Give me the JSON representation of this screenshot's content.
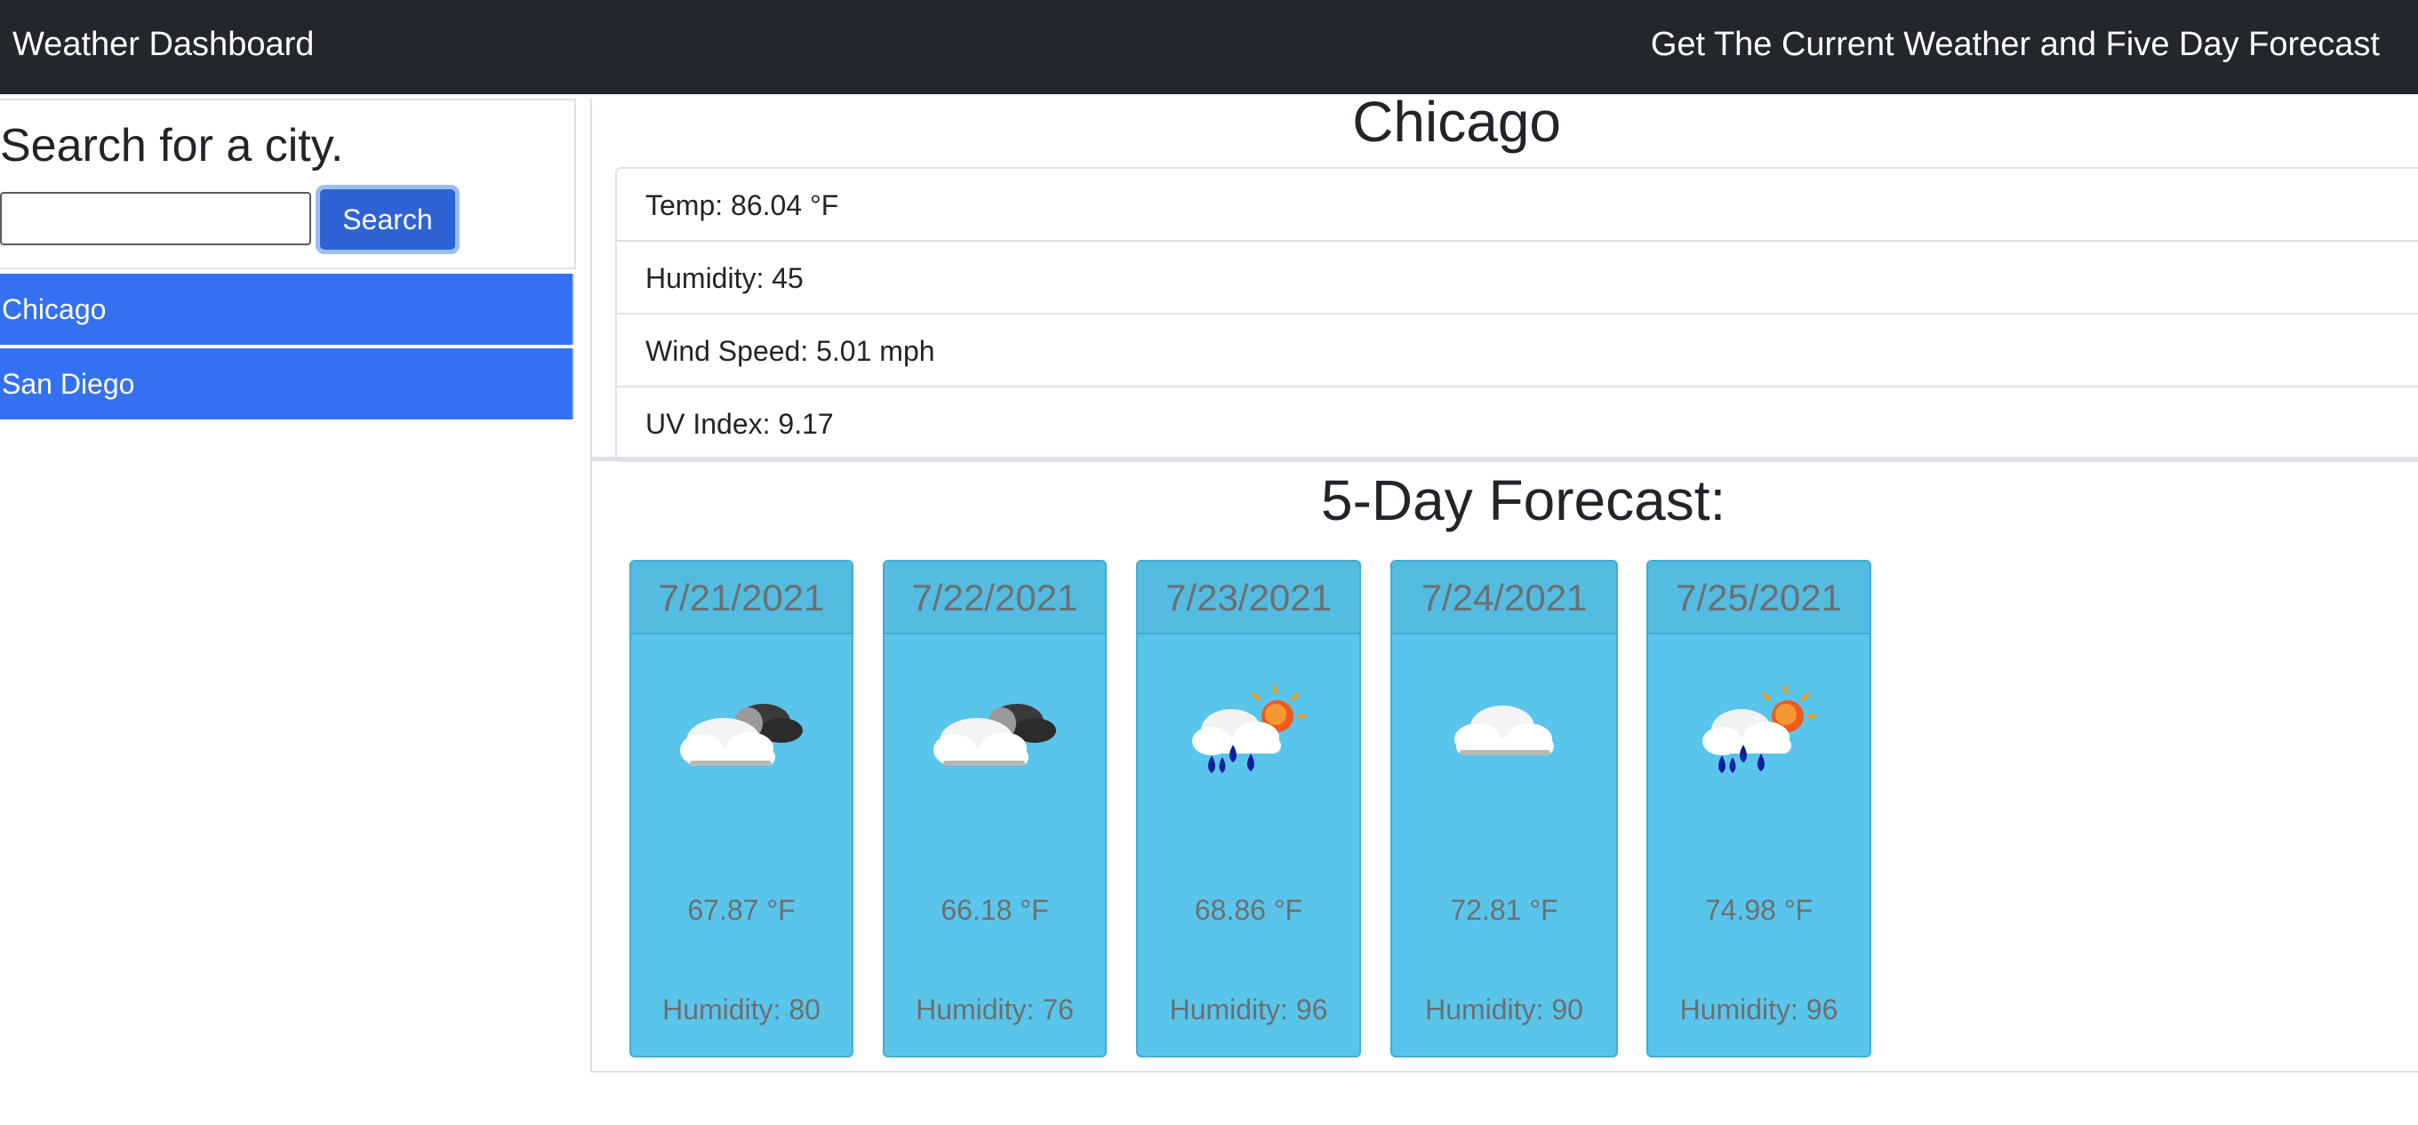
{
  "navbar": {
    "brand": "Weather Dashboard",
    "tagline": "Get The Current Weather and Five Day Forecast"
  },
  "search": {
    "heading": "Search for a city.",
    "input_value": "",
    "placeholder": "",
    "button_label": "Search"
  },
  "history": [
    "Chicago",
    "San Diego"
  ],
  "current": {
    "city": "Chicago",
    "temp": "Temp: 86.04 °F",
    "humidity": "Humidity: 45",
    "wind": "Wind Speed: 5.01 mph",
    "uv": "UV Index: 9.17"
  },
  "forecast": {
    "title": "5-Day Forecast:",
    "days": [
      {
        "date": "7/21/2021",
        "icon": "broken-clouds-icon",
        "temp": "67.87 °F",
        "humidity": "Humidity: 80"
      },
      {
        "date": "7/22/2021",
        "icon": "broken-clouds-icon",
        "temp": "66.18 °F",
        "humidity": "Humidity: 76"
      },
      {
        "date": "7/23/2021",
        "icon": "rain-sun-icon",
        "temp": "68.86 °F",
        "humidity": "Humidity: 96"
      },
      {
        "date": "7/24/2021",
        "icon": "cloud-icon",
        "temp": "72.81 °F",
        "humidity": "Humidity: 90"
      },
      {
        "date": "7/25/2021",
        "icon": "rain-sun-icon",
        "temp": "74.98 °F",
        "humidity": "Humidity: 96"
      }
    ]
  },
  "colors": {
    "navbar": "#23262a",
    "history_item": "#3471f2",
    "search_button": "#2e63d6",
    "card": "#5ac5ea",
    "card_text": "#6c6f72"
  }
}
